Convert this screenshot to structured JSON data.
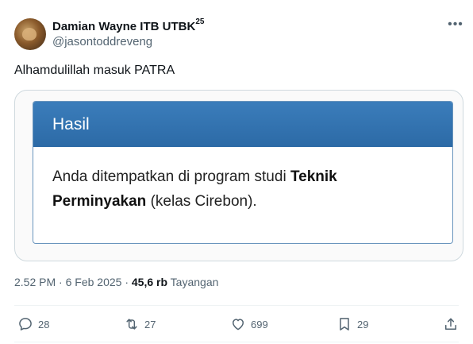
{
  "author": {
    "display_name": "Damian Wayne ITB UTBK",
    "name_superscript": "25",
    "handle": "@jasontoddreveng"
  },
  "more_icon": "more-horizontal-icon",
  "tweet": {
    "text": "Alhamdulillah masuk PATRA"
  },
  "media": {
    "card_title": "Hasil",
    "body_prefix": "Anda ditempatkan di program studi ",
    "body_bold_1": "Teknik",
    "body_bold_2": "Perminyakan",
    "body_suffix": " (kelas Cirebon)."
  },
  "meta": {
    "time": "2.52 PM",
    "separator": "·",
    "date": "6 Feb 2025",
    "views_count": "45,6 rb",
    "views_label": "Tayangan"
  },
  "actions": {
    "replies": "28",
    "reposts": "27",
    "likes": "699",
    "bookmarks": "29"
  },
  "icons": {
    "reply": "reply-icon",
    "repost": "repost-icon",
    "like": "heart-icon",
    "bookmark": "bookmark-icon",
    "share": "share-icon"
  },
  "colors": {
    "card_header": "#2f6fab",
    "muted_text": "#536471",
    "primary_text": "#0f1419"
  }
}
